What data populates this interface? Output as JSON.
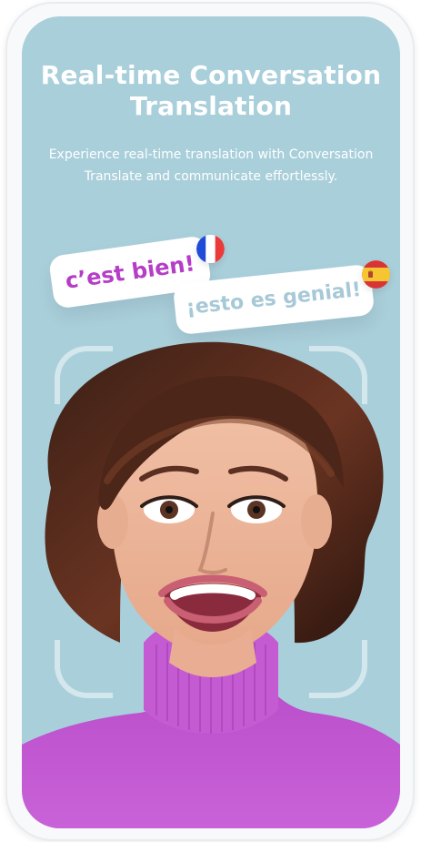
{
  "title": "Real-time Conversation\nTranslation",
  "subtitle": "Experience real-time translation with Conversation\nTranslate and communicate effortlessly.",
  "bubbles": [
    {
      "text": "c’est bien!",
      "language": "French",
      "flag_icon": "france-flag-icon"
    },
    {
      "text": "¡esto es genial!",
      "language": "Spanish",
      "flag_icon": "spain-flag-icon"
    }
  ],
  "colors": {
    "background": "#a9cfdb",
    "text": "#ffffff",
    "french_text": "#b63dc7",
    "spanish_text": "#a7c9d7",
    "sweater": "#c65dd4"
  }
}
